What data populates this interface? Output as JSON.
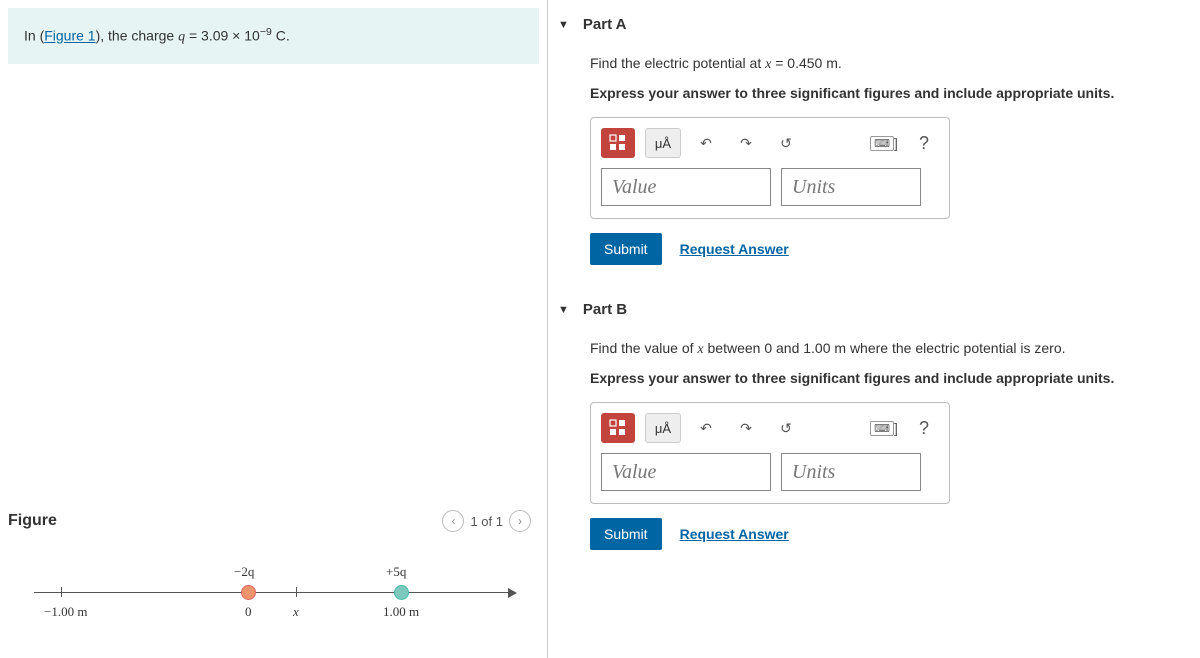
{
  "problem": {
    "prefix": "In (",
    "figure_link": "Figure 1",
    "suffix_1": "), the charge ",
    "var": "q",
    "eq": " = 3.09 × 10",
    "exp": "−9",
    "unit": " C."
  },
  "figure": {
    "title": "Figure",
    "counter": "1 of 1",
    "labels": {
      "neg2q": "−2q",
      "pos5q": "+5q",
      "zero": "0",
      "x": "x",
      "negOne": "−1.00 m",
      "posOne": "1.00 m"
    }
  },
  "partA": {
    "title": "Part A",
    "prompt_prefix": "Find the electric potential at ",
    "prompt_var": "x",
    "prompt_eq": " = 0.450 m",
    "prompt_suffix": ".",
    "instruction": "Express your answer to three significant figures and include appropriate units.",
    "value_placeholder": "Value",
    "units_placeholder": "Units",
    "submit": "Submit",
    "request": "Request Answer"
  },
  "partB": {
    "title": "Part B",
    "prompt_prefix": "Find the value of ",
    "prompt_var": "x",
    "prompt_mid": " between 0 and 1.00 m where the electric potential is zero.",
    "instruction": "Express your answer to three significant figures and include appropriate units.",
    "value_placeholder": "Value",
    "units_placeholder": "Units",
    "submit": "Submit",
    "request": "Request Answer"
  },
  "toolbar": {
    "units_btn": "μÅ",
    "help": "?"
  }
}
